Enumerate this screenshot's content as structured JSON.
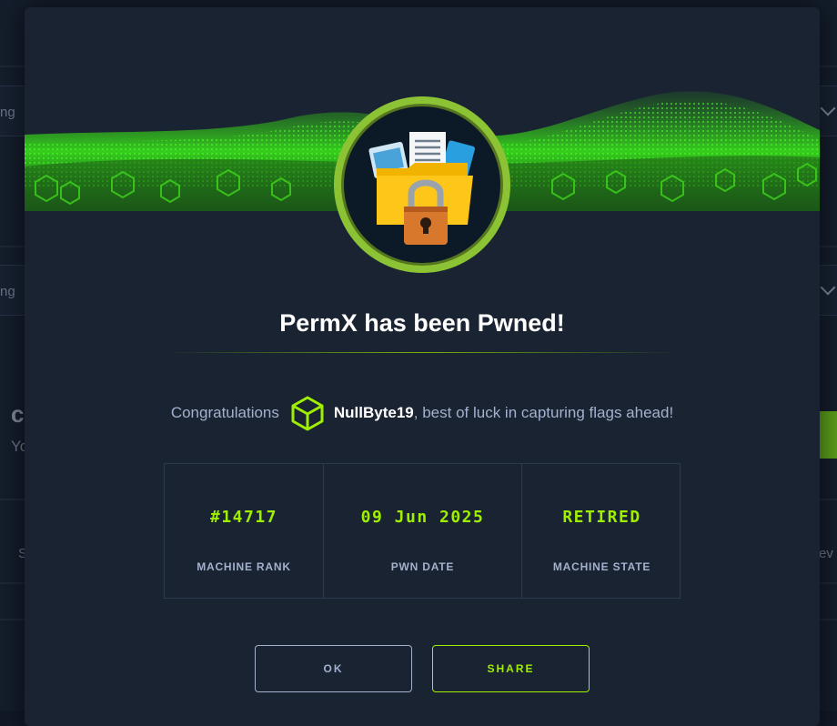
{
  "background": {
    "field_1_text": "ng",
    "field_2_text": "ng",
    "side_text_c": "c",
    "side_text_y": "Yo",
    "side_text_s": "S",
    "side_text_ev": "ev"
  },
  "modal": {
    "title": "PermX has been Pwned!",
    "congrats_prefix": "Congratulations",
    "username": "NullByte19",
    "congrats_suffix": ", best of luck in capturing flags ahead!",
    "stats": [
      {
        "value": "#14717",
        "label": "MACHINE RANK"
      },
      {
        "value": "09 Jun 2025",
        "label": "PWN DATE"
      },
      {
        "value": "RETIRED",
        "label": "MACHINE STATE"
      }
    ],
    "ok_label": "OK",
    "share_label": "SHARE"
  },
  "colors": {
    "accent": "#9fef00",
    "modal_bg": "#1a2332",
    "muted_text": "#a4b1cd",
    "ring": "#8bc334"
  },
  "icons": {
    "avatar": "folder-lock-icon",
    "user": "cube-icon"
  }
}
